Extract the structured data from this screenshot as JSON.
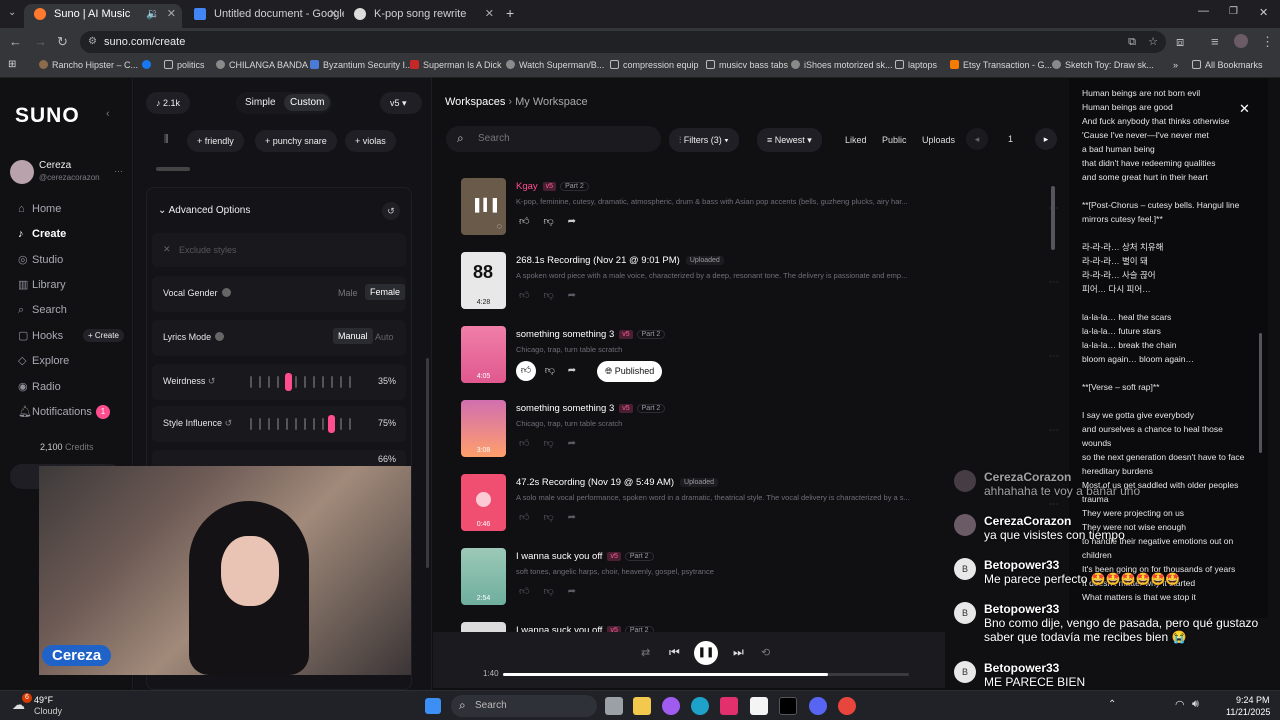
{
  "browser": {
    "tabs": [
      {
        "label": "Suno | AI Music",
        "active": true
      },
      {
        "label": "Untitled document - Google Do",
        "active": false
      },
      {
        "label": "K-pop song rewrite",
        "active": false
      }
    ],
    "url": "suno.com/create",
    "bookmarks": [
      "Rancho Hipster – C...",
      "politics",
      "CHILANGA BANDA",
      "Byzantium Security I...",
      "Superman Is A Dick",
      "Watch Superman/B...",
      "compression equip",
      "musicv bass tabs",
      "iShoes motorized sk...",
      "laptops",
      "Etsy Transaction - G...",
      "Sketch Toy: Draw sk...",
      "All Bookmarks"
    ]
  },
  "sidebar": {
    "logo": "SUNO",
    "user": {
      "name": "Cereza",
      "handle": "@cerezacorazon"
    },
    "items": [
      {
        "label": "Home",
        "icon": "home-icon"
      },
      {
        "label": "Create",
        "icon": "create-icon"
      },
      {
        "label": "Studio",
        "icon": "studio-icon"
      },
      {
        "label": "Library",
        "icon": "library-icon"
      },
      {
        "label": "Search",
        "icon": "search-icon"
      },
      {
        "label": "Hooks",
        "icon": "hooks-icon"
      },
      {
        "label": "Explore",
        "icon": "explore-icon"
      },
      {
        "label": "Radio",
        "icon": "radio-icon"
      },
      {
        "label": "Notifications",
        "icon": "bell-icon"
      }
    ],
    "hooks_create": "+ Create",
    "notifications_count": "1",
    "credits": "2,100",
    "credits_label": "Credits"
  },
  "create": {
    "credits_chip": "2.1k",
    "mode_simple": "Simple",
    "mode_custom": "Custom",
    "version": "v5",
    "tags": [
      "friendly",
      "punchy snare",
      "violas"
    ],
    "advanced_title": "Advanced Options",
    "exclude_placeholder": "Exclude styles",
    "vocal_gender_label": "Vocal Gender",
    "vocal_male": "Male",
    "vocal_female": "Female",
    "lyrics_mode_label": "Lyrics Mode",
    "lyrics_manual": "Manual",
    "lyrics_auto": "Auto",
    "weirdness_label": "Weirdness",
    "weirdness_value": "35%",
    "weirdness_level": 0.35,
    "style_influence_label": "Style Influence",
    "style_influence_value": "75%",
    "style_influence_level": 0.75,
    "partial_value": "66%"
  },
  "workspace": {
    "breadcrumb_root": "Workspaces",
    "breadcrumb_current": "My Workspace",
    "search_placeholder": "Search",
    "filters_label": "Filters (3)",
    "sort_label": "Newest",
    "chips": [
      "Liked",
      "Public",
      "Uploads"
    ],
    "page": "1",
    "tracks": [
      {
        "title": "Kgay",
        "badge": "v5",
        "part": "Part 2",
        "desc": "K-pop, feminine, cutesy, dramatic, atmospheric, drum & bass with Asian pop accents (bells, guzheng plucks, airy har...",
        "duration": "",
        "color": "#6a5a4a"
      },
      {
        "title": "268.1s Recording (Nov 21 @ 9:01 PM)",
        "uploaded": "Uploaded",
        "desc": "A spoken word piece with a male voice, characterized by a deep, resonant tone. The delivery is passionate and emp...",
        "duration": "4:28",
        "color": "#e8e8e8"
      },
      {
        "title": "something something 3",
        "badge": "v5",
        "part": "Part 2",
        "desc": "Chicago, trap, turn table scratch",
        "duration": "4:05",
        "color": "#e0588f",
        "published": "Published"
      },
      {
        "title": "something something 3",
        "badge": "v5",
        "part": "Part 2",
        "desc": "Chicago, trap, turn table scratch",
        "duration": "3:08",
        "color": "#d16fb0"
      },
      {
        "title": "47.2s Recording (Nov 19 @ 5:49 AM)",
        "uploaded": "Uploaded",
        "desc": "A solo male vocal performance, spoken word in a dramatic, theatrical style. The vocal delivery is characterized by a s...",
        "duration": "0:46",
        "color": "#f04f72"
      },
      {
        "title": "I wanna suck you off",
        "badge": "v5",
        "part": "Part 2",
        "desc": "soft tones, angelic harps, choir, heavenly, gospel, psytrance",
        "duration": "2:54",
        "color": "#7fb8a8"
      },
      {
        "title": "I wanna suck you off",
        "badge": "v5",
        "part": "Part 2",
        "desc": "",
        "duration": "",
        "color": "#dcdcdc"
      }
    ]
  },
  "lyrics": {
    "lines": [
      "Human beings are not born evil",
      "Human beings are good",
      "And fuck anybody that thinks otherwise",
      "'Cause I've never—I've never met",
      "a bad human being",
      "that didn't have redeeming qualities",
      "and some great hurt in their heart",
      "",
      "**[Post-Chorus – cutesy bells. Hangul line mirrors cutesy feel.]**",
      "",
      "라-라-라… 상처 치유해",
      "라-라-라… 별이 돼",
      "라-라-라… 사슬 끊어",
      "피어… 다시 피어…",
      "",
      "la-la-la… heal the scars",
      "la-la-la… future stars",
      "la-la-la… break the chain",
      "bloom again… bloom again…",
      "",
      "**[Verse – soft rap]**",
      "",
      "I say we gotta give everybody",
      " and ourselves a chance to heal those wounds",
      " so the next generation doesn't have to face hereditary burdens",
      "Most of us get saddled with older peoples trauma",
      "They were projecting on us",
      "They were not wise enough",
      "to handle their negative emotions out on children",
      "It's been going on for thousands of years",
      "It doesn't matter why it started",
      "What matters is that we stop it"
    ]
  },
  "chat": [
    {
      "user": "CerezaCorazon",
      "msg": "ahhahaha te voy a bañar uno"
    },
    {
      "user": "CerezaCorazon",
      "msg": "ya que visistes con tiempo"
    },
    {
      "user": "Betopower33",
      "msg": "Me parece perfecto 🤩🤩🤩🤩🤩🤩"
    },
    {
      "user": "Betopower33",
      "msg": "Bno como dije, vengo de pasada, pero qué gustazo saber que todavía me recibes bien 😭"
    },
    {
      "user": "Betopower33",
      "msg": "ME PARECE BIEN"
    }
  ],
  "webcam": {
    "name_tag": "Cereza"
  },
  "player": {
    "elapsed": "1:40",
    "progress": 0.8
  },
  "taskbar": {
    "weather_temp": "49°F",
    "weather_desc": "Cloudy",
    "weather_badge": "6",
    "search_placeholder": "Search",
    "time": "9:24 PM",
    "date": "11/21/2025"
  },
  "colors": {
    "accent": "#ff4d8d",
    "brand": "#ffffff",
    "bg": "#101013"
  }
}
